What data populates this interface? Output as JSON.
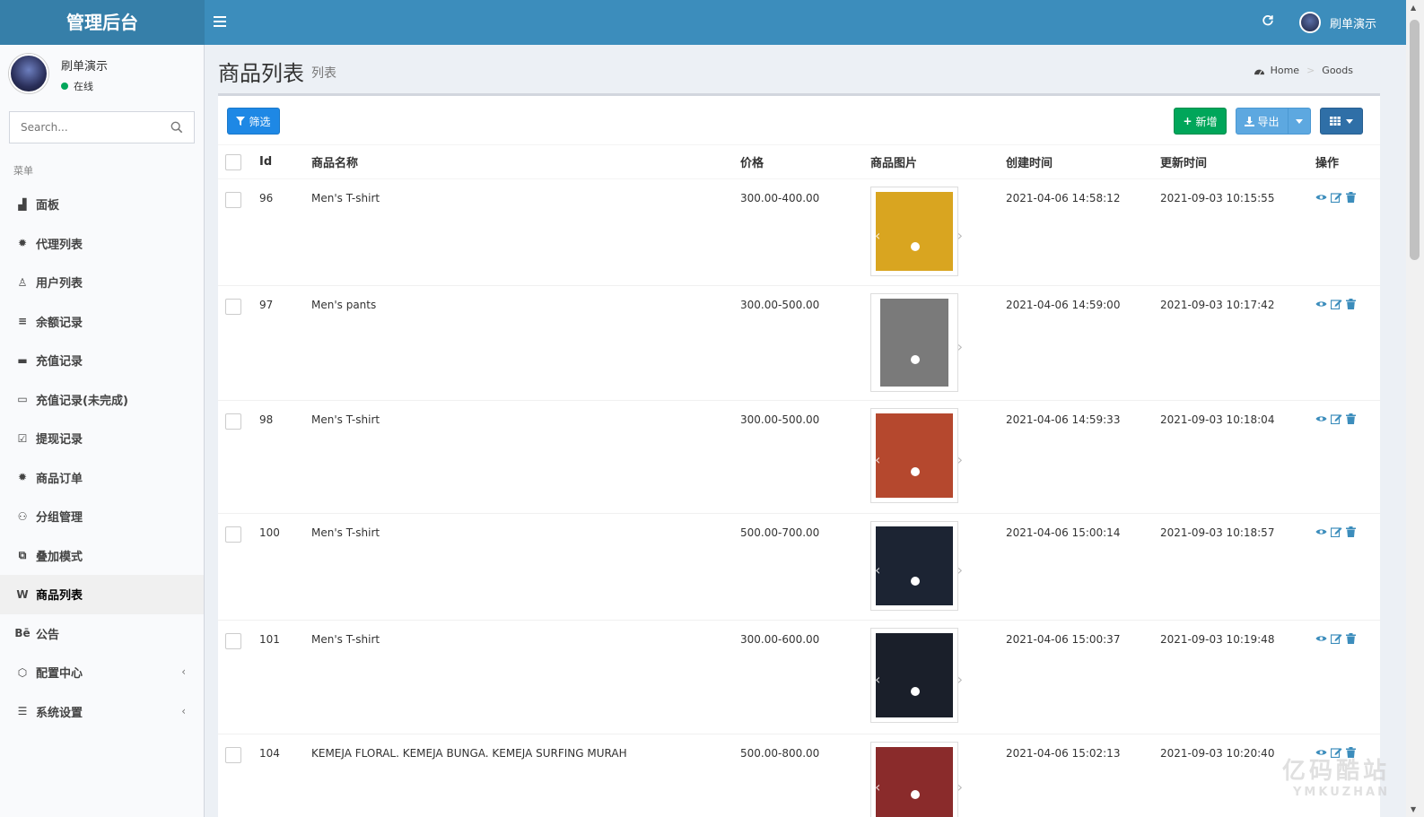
{
  "app": {
    "title": "管理后台"
  },
  "topbar": {
    "user_name": "刷单演示"
  },
  "user_panel": {
    "name": "刷单演示",
    "status": "在线"
  },
  "search": {
    "placeholder": "Search..."
  },
  "sidebar": {
    "header": "菜单",
    "items": [
      {
        "label": "面板",
        "icon": "area-chart-icon"
      },
      {
        "label": "代理列表",
        "icon": "gear-icon"
      },
      {
        "label": "用户列表",
        "icon": "user-icon"
      },
      {
        "label": "余额记录",
        "icon": "list-icon"
      },
      {
        "label": "充值记录",
        "icon": "credit-card-icon"
      },
      {
        "label": "充值记录(未完成)",
        "icon": "credit-card-outline-icon"
      },
      {
        "label": "提现记录",
        "icon": "checkbox-icon"
      },
      {
        "label": "商品订单",
        "icon": "gear-icon"
      },
      {
        "label": "分组管理",
        "icon": "users-icon"
      },
      {
        "label": "叠加模式",
        "icon": "object-group-icon"
      },
      {
        "label": "商品列表",
        "icon": "wikipedia-icon",
        "active": true
      },
      {
        "label": "公告",
        "icon": "behance-icon"
      },
      {
        "label": "配置中心",
        "icon": "puzzle-icon",
        "has_children": true
      },
      {
        "label": "系统设置",
        "icon": "server-icon",
        "has_children": true
      }
    ]
  },
  "page": {
    "title": "商品列表",
    "subtitle": "列表"
  },
  "breadcrumb": {
    "home": "Home",
    "current": "Goods"
  },
  "toolbar": {
    "filter_label": "筛选",
    "add_label": "新增",
    "export_label": "导出"
  },
  "table": {
    "headers": {
      "id": "Id",
      "name": "商品名称",
      "price": "价格",
      "image": "商品图片",
      "created": "创建时间",
      "updated": "更新时间",
      "actions": "操作"
    },
    "rows": [
      {
        "id": "96",
        "name": "Men's T-shirt",
        "price": "300.00-400.00",
        "created": "2021-04-06 14:58:12",
        "updated": "2021-09-03 10:15:55",
        "image_color": "#d9a520"
      },
      {
        "id": "97",
        "name": "Men's pants",
        "price": "300.00-500.00",
        "created": "2021-04-06 14:59:00",
        "updated": "2021-09-03 10:17:42",
        "image_color": "#7a7a7a"
      },
      {
        "id": "98",
        "name": "Men's T-shirt",
        "price": "300.00-500.00",
        "created": "2021-04-06 14:59:33",
        "updated": "2021-09-03 10:18:04",
        "image_color": "#b5482e"
      },
      {
        "id": "100",
        "name": "Men's T-shirt",
        "price": "500.00-700.00",
        "created": "2021-04-06 15:00:14",
        "updated": "2021-09-03 10:18:57",
        "image_color": "#1c2433"
      },
      {
        "id": "101",
        "name": "Men's T-shirt",
        "price": "300.00-600.00",
        "created": "2021-04-06 15:00:37",
        "updated": "2021-09-03 10:19:48",
        "image_color": "#1a1f2a"
      },
      {
        "id": "104",
        "name": "KEMEJA FLORAL. KEMEJA BUNGA. KEMEJA SURFING MURAH",
        "price": "500.00-800.00",
        "created": "2021-04-06 15:02:13",
        "updated": "2021-09-03 10:20:40",
        "image_color": "#8a2b2b"
      }
    ]
  },
  "watermark": {
    "main": "亿码酷站",
    "sub": "YMKUZHAN"
  },
  "colors": {
    "header": "#3c8dbc",
    "logo": "#367fa9",
    "filter": "#1e88e5",
    "add": "#00a65a",
    "export": "#5da8e0",
    "columns": "#2f6fa7",
    "online": "#00a65a"
  }
}
